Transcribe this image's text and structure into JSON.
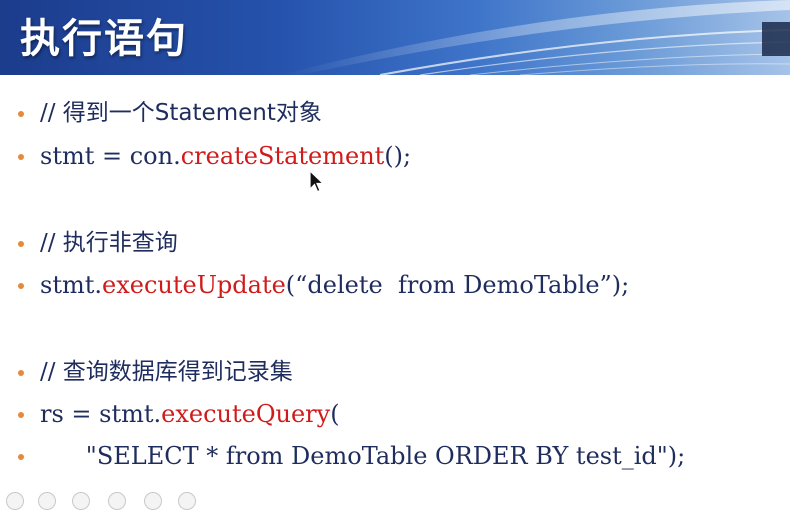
{
  "slide": {
    "title": "执行语句"
  },
  "content": {
    "lines": [
      {
        "type": "comment",
        "text": "// 得到一个Statement对象"
      },
      {
        "type": "code",
        "prefix": "stmt = con.",
        "fn": "createStatement",
        "suffix": "();"
      },
      {
        "type": "comment",
        "text": "// 执行非查询"
      },
      {
        "type": "code",
        "prefix": "stmt.",
        "fn": "executeUpdate",
        "suffix": "(“delete  from DemoTable”);"
      },
      {
        "type": "comment",
        "text": "// 查询数据库得到记录集"
      },
      {
        "type": "code",
        "prefix": "rs = stmt.",
        "fn": "executeQuery",
        "suffix": "("
      },
      {
        "type": "plain",
        "text": "      \"SELECT * from DemoTable ORDER BY test_id\");"
      }
    ]
  },
  "colors": {
    "bullet": "#e8883a",
    "text": "#1f2d5e",
    "method": "#d01b1b",
    "header_dark": "#1c3c8c"
  },
  "icons": {
    "cursor": "mouse-pointer-icon",
    "player_controls": [
      "prev-icon",
      "back-icon",
      "pointer-icon",
      "menu-icon",
      "zoom-icon",
      "next-icon"
    ]
  }
}
